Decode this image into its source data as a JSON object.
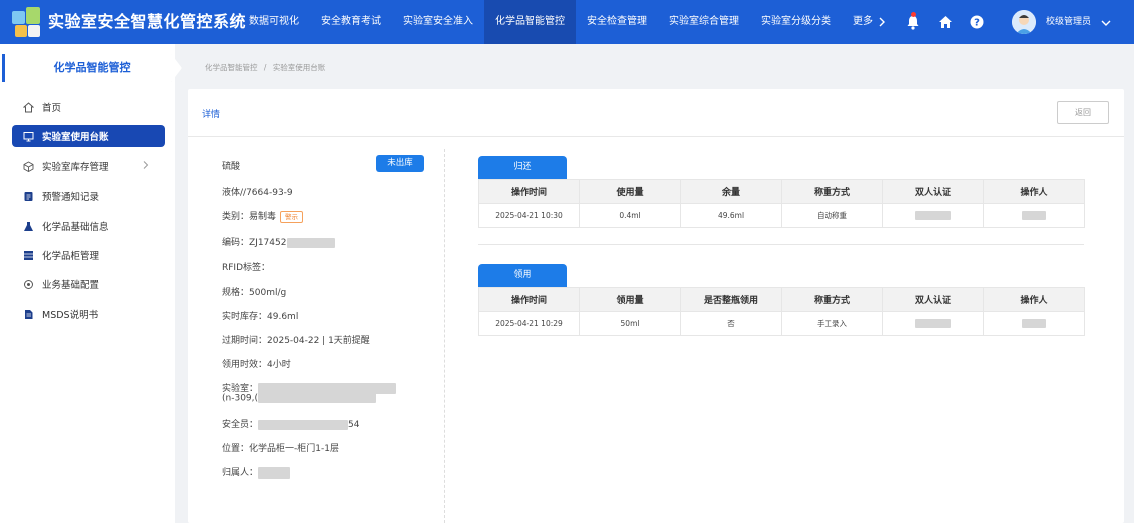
{
  "app": {
    "title": "实验室安全智慧化管控系统"
  },
  "nav": {
    "items": [
      "数据可视化",
      "安全教育考试",
      "实验室安全准入",
      "化学品智能管控",
      "安全检查管理",
      "实验室综合管理",
      "实验室分级分类"
    ],
    "active_index": 3,
    "more_label": "更多"
  },
  "user": {
    "name": "校级管理员"
  },
  "sidebar": {
    "header": "化学品智能管控",
    "items": [
      {
        "label": "首页",
        "icon": "home-icon"
      },
      {
        "label": "实验室使用台账",
        "icon": "monitor-icon",
        "active": true
      },
      {
        "label": "实验室库存管理",
        "icon": "box-icon",
        "expandable": true
      },
      {
        "label": "预警通知记录",
        "icon": "alert-list-icon"
      },
      {
        "label": "化学品基础信息",
        "icon": "flask-icon"
      },
      {
        "label": "化学品柜管理",
        "icon": "cabinet-icon"
      },
      {
        "label": "业务基础配置",
        "icon": "settings-icon"
      },
      {
        "label": "MSDS说明书",
        "icon": "document-icon"
      }
    ]
  },
  "breadcrumb": {
    "root": "化学品智能管控",
    "sep": "/",
    "current": "实验室使用台账"
  },
  "detail": {
    "title": "详情",
    "back_label": "返回",
    "chemical": {
      "name": "硫酸",
      "status": "未出库",
      "cas": "液体//7664-93-9",
      "category_label": "类别：",
      "category": "易制毒",
      "category_tag": "警示",
      "code_label": "编码：",
      "code": "ZJ17452",
      "rfid_label": "RFID标签：",
      "spec_label": "规格：",
      "spec": "500ml/g",
      "stock_label": "实时库存：",
      "stock": "49.6ml",
      "expiry_label": "过期时间：",
      "expiry": "2025-04-22 | 1天前提醒",
      "duration_label": "领用时效：",
      "duration": "4小时",
      "lab_label": "实验室：",
      "lab_suffix": "(n-309,(",
      "safety_label": "安全员：",
      "safety_suffix": "54",
      "location_label": "位置：",
      "location": "化学品柜一-柜门1-1层",
      "owner_label": "归属人："
    },
    "return_table": {
      "tab": "归还",
      "headers": [
        "操作时间",
        "使用量",
        "余量",
        "称重方式",
        "双人认证",
        "操作人"
      ],
      "rows": [
        [
          "2025-04-21 10:30",
          "0.4ml",
          "49.6ml",
          "自动称重",
          "",
          ""
        ]
      ]
    },
    "use_table": {
      "tab": "领用",
      "headers": [
        "操作时间",
        "领用量",
        "是否整瓶领用",
        "称重方式",
        "双人认证",
        "操作人"
      ],
      "rows": [
        [
          "2025-04-21 10:29",
          "50ml",
          "否",
          "手工录入",
          "",
          ""
        ]
      ]
    }
  }
}
